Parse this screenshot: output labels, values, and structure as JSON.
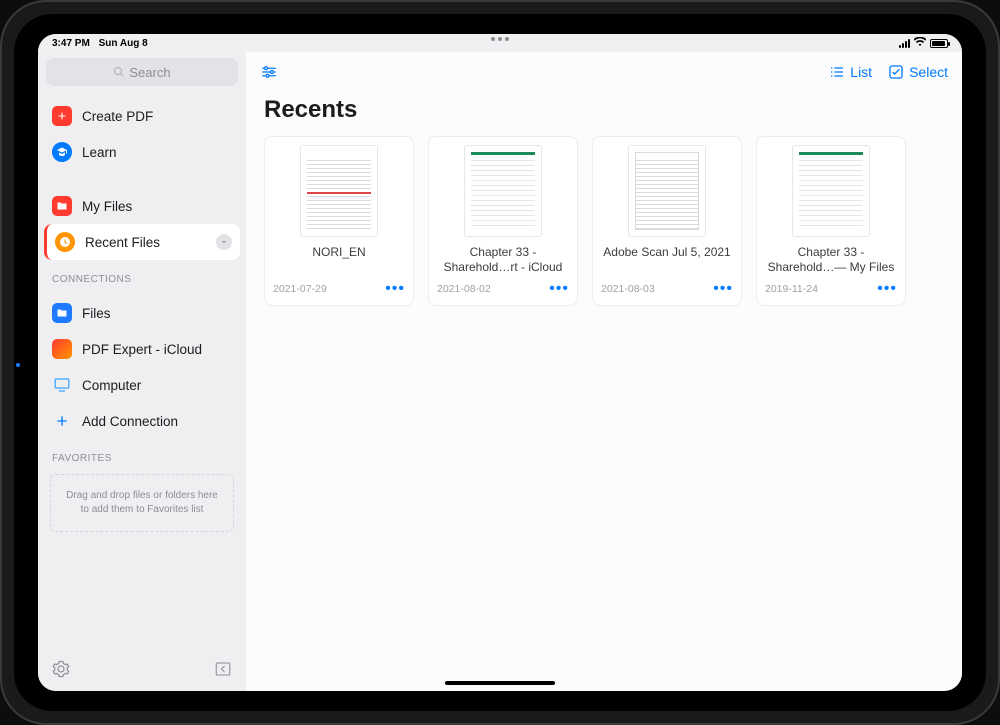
{
  "status_bar": {
    "time": "3:47 PM",
    "date": "Sun Aug 8"
  },
  "sidebar": {
    "search_placeholder": "Search",
    "primary": [
      {
        "label": "Create PDF",
        "icon": "plus-file-icon",
        "selected": false
      },
      {
        "label": "Learn",
        "icon": "learn-icon",
        "selected": false
      }
    ],
    "locations": [
      {
        "label": "My Files",
        "icon": "folder-icon",
        "selected": false
      },
      {
        "label": "Recent Files",
        "icon": "clock-icon",
        "selected": true
      }
    ],
    "connections_header": "CONNECTIONS",
    "connections": [
      {
        "label": "Files",
        "icon": "files-app-icon"
      },
      {
        "label": "PDF Expert - iCloud",
        "icon": "pdfexpert-icon"
      },
      {
        "label": "Computer",
        "icon": "computer-icon"
      },
      {
        "label": "Add Connection",
        "icon": "plus-icon"
      }
    ],
    "favorites_header": "FAVORITES",
    "favorites_drop_text": "Drag and drop files or folders here to add them to Favorites list"
  },
  "toolbar": {
    "list_label": "List",
    "select_label": "Select"
  },
  "page_title": "Recents",
  "files": [
    {
      "name": "NORI_EN",
      "date": "2021-07-29",
      "thumb": "form"
    },
    {
      "name": "Chapter 33 - Sharehold…rt - iCloud",
      "date": "2021-08-02",
      "thumb": "green"
    },
    {
      "name": "Adobe Scan Jul 5, 2021",
      "date": "2021-08-03",
      "thumb": "bordered"
    },
    {
      "name": "Chapter 33 - Sharehold…— My Files",
      "date": "2019-11-24",
      "thumb": "green"
    }
  ]
}
